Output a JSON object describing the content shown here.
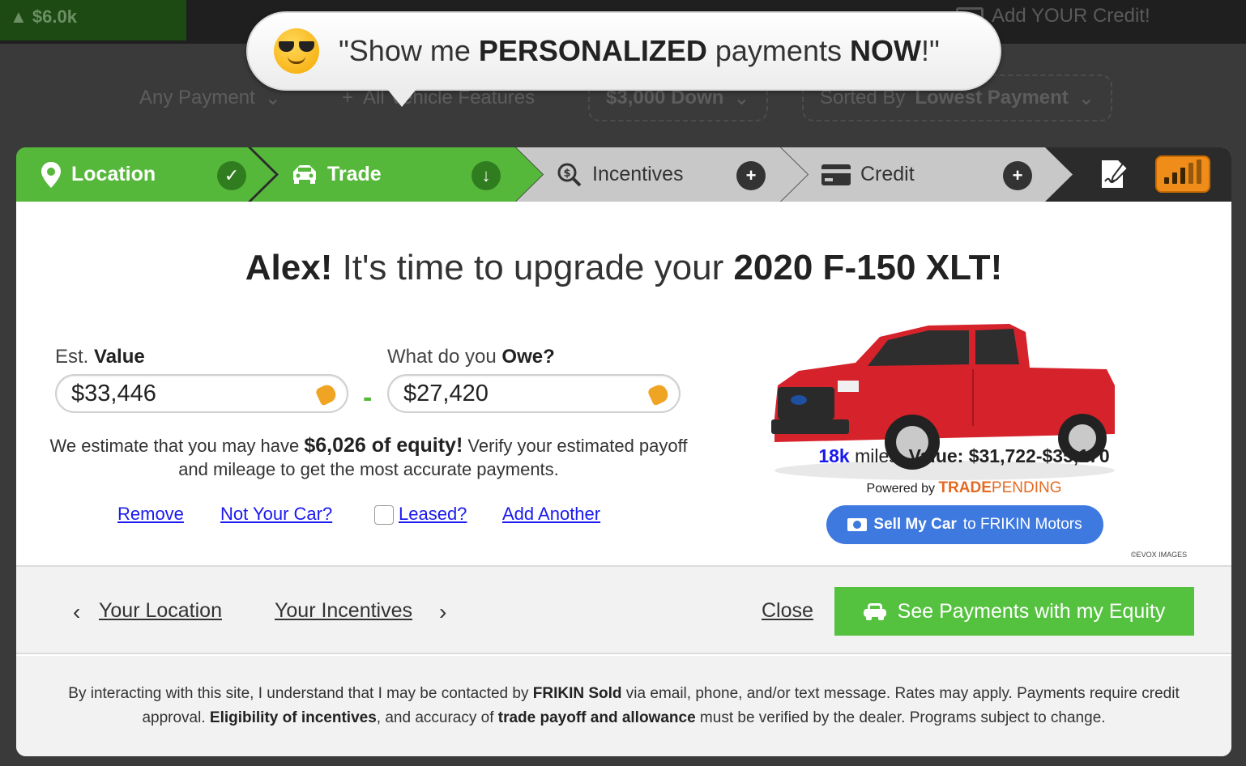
{
  "background": {
    "equity_chip": "$6.0k",
    "add_credit": "Add YOUR Credit!",
    "filters": {
      "payment": "Any Payment",
      "features": "All Vehicle Features",
      "down": "$3,000 Down",
      "sort_prefix": "Sorted By",
      "sort_value": "Lowest Payment"
    }
  },
  "bubble": {
    "open_quote": "\"Show me ",
    "bold1": "PERSONALIZED",
    "middle": " payments ",
    "bold2": "NOW",
    "end": "!\""
  },
  "steps": {
    "location": "Location",
    "trade": "Trade",
    "incentives": "Incentives",
    "credit": "Credit",
    "location_status": "✓",
    "trade_status": "↓",
    "incentives_status": "+",
    "credit_status": "+"
  },
  "headline": {
    "name": "Alex!",
    "middle": " It's time to upgrade your ",
    "vehicle": "2020 F-150 XLT!"
  },
  "trade": {
    "value_label_prefix": "Est. ",
    "value_label_bold": "Value",
    "value": "$33,446",
    "owe_label_prefix": "What do you ",
    "owe_label_bold": "Owe?",
    "owe": "$27,420",
    "minus": "-",
    "equity_pre": "We estimate that you may have ",
    "equity_bold": "$6,026 of equity!",
    "equity_post": " Verify your estimated payoff and mileage to get the most accurate payments."
  },
  "links": {
    "remove": "Remove",
    "not_your_car": "Not Your Car?",
    "leased": "Leased?",
    "add_another": "Add Another"
  },
  "vehicle_card": {
    "miles": "18k",
    "miles_suffix": " miles, ",
    "value_label": "Value: $31,722-$35,170",
    "powered_by": "Powered by ",
    "brand_bold": "TRADE",
    "brand_light": "PENDING",
    "sell_bold": "Sell My Car",
    "sell_rest": " to FRIKIN Motors",
    "evox": "©EVOX IMAGES"
  },
  "colors": {
    "green": "#55b83a",
    "cta_green": "#55c23f",
    "blue_link": "#1a1aee",
    "sell_blue": "#3e79e0",
    "orange": "#f08c1a",
    "truck_red": "#d6222b"
  },
  "footer_nav": {
    "back": "Your Location",
    "next": "Your Incentives",
    "close": "Close",
    "cta": "See Payments with my Equity"
  },
  "disclaimer": {
    "p1": "By interacting with this site, I understand that I may be contacted by ",
    "b1": "FRIKIN Sold",
    "p2": " via email, phone, and/or text message. Rates may apply. Payments require credit approval. ",
    "b2": "Eligibility of incentives",
    "p3": ", and accuracy of ",
    "b3": "trade payoff and allowance",
    "p4": " must be verified by the dealer. Programs subject to change."
  }
}
